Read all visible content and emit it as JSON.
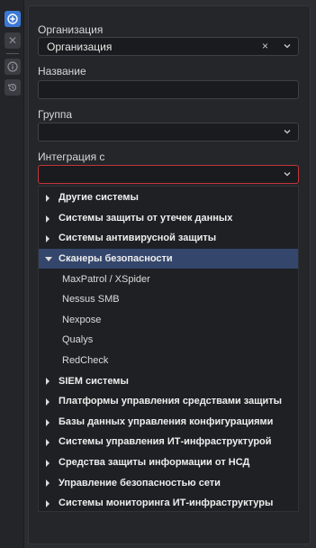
{
  "toolbar": {
    "add_icon": "plus-circle-icon",
    "close_icon": "close-icon",
    "close_glyph": "✕",
    "info_icon": "info-icon",
    "history_icon": "history-icon"
  },
  "form": {
    "organization": {
      "label": "Организация",
      "value": "Организация",
      "clear_glyph": "×"
    },
    "name": {
      "label": "Название",
      "value": ""
    },
    "group": {
      "label": "Группа",
      "value": ""
    },
    "integration": {
      "label": "Интеграция с",
      "value": "",
      "error_color": "#c2353b"
    }
  },
  "dropdown": {
    "items": [
      {
        "label": "Другие системы",
        "type": "group",
        "expanded": false
      },
      {
        "label": "Системы защиты от утечек данных",
        "type": "group",
        "expanded": false
      },
      {
        "label": "Системы антивирусной защиты",
        "type": "group",
        "expanded": false
      },
      {
        "label": "Сканеры безопасности",
        "type": "group",
        "expanded": true,
        "selected": true
      },
      {
        "label": "MaxPatrol / XSpider",
        "type": "child"
      },
      {
        "label": "Nessus SMB",
        "type": "child"
      },
      {
        "label": "Nexpose",
        "type": "child"
      },
      {
        "label": "Qualys",
        "type": "child"
      },
      {
        "label": "RedCheck",
        "type": "child"
      },
      {
        "label": "SIEM системы",
        "type": "group",
        "expanded": false
      },
      {
        "label": "Платформы управления средствами защиты",
        "type": "group",
        "expanded": false
      },
      {
        "label": "Базы данных управления конфигурациями",
        "type": "group",
        "expanded": false
      },
      {
        "label": "Системы управления ИТ-инфраструктурой",
        "type": "group",
        "expanded": false
      },
      {
        "label": "Средства защиты информации от НСД",
        "type": "group",
        "expanded": false
      },
      {
        "label": "Управление безопасностью сети",
        "type": "group",
        "expanded": false
      },
      {
        "label": "Системы мониторинга ИТ-инфраструктуры",
        "type": "group",
        "expanded": false
      }
    ]
  },
  "colors": {
    "accent": "#3c79d6",
    "selected_row": "#34466b",
    "error": "#c2353b"
  }
}
